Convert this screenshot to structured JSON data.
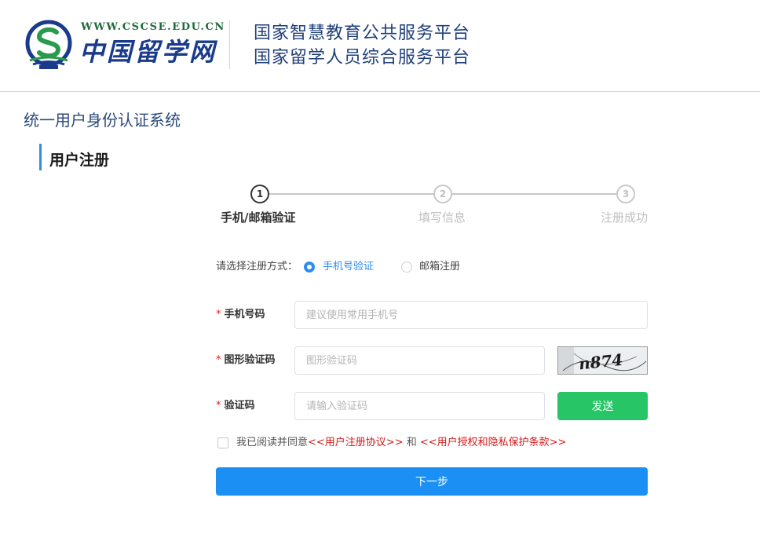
{
  "header": {
    "logo_url": "WWW.CSCSE.EDU.CN",
    "logo_name": "中国留学网",
    "platform_line1": "国家智慧教育公共服务平台",
    "platform_line2": "国家留学人员综合服务平台"
  },
  "system_title": "统一用户身份认证系统",
  "section_title": "用户注册",
  "steps": [
    {
      "number": "1",
      "label": "手机/邮箱验证",
      "active": true
    },
    {
      "number": "2",
      "label": "填写信息",
      "active": false
    },
    {
      "number": "3",
      "label": "注册成功",
      "active": false
    }
  ],
  "method": {
    "label": "请选择注册方式：",
    "options": [
      {
        "label": "手机号验证",
        "selected": true
      },
      {
        "label": "邮箱注册",
        "selected": false
      }
    ]
  },
  "form": {
    "required_mark": "*",
    "phone": {
      "label": "手机号码",
      "placeholder": "建议使用常用手机号",
      "value": ""
    },
    "captcha": {
      "label": "图形验证码",
      "placeholder": "图形验证码",
      "value": "",
      "image_text": "n874"
    },
    "code": {
      "label": "验证码",
      "placeholder": "请输入验证码",
      "value": "",
      "send_label": "发送"
    }
  },
  "agreement": {
    "prefix": "我已阅读并同意",
    "link1": "<<用户注册协议>>",
    "conjunction": " 和 ",
    "link2": "<<用户授权和隐私保护条款>>",
    "checked": false
  },
  "next_button": "下一步",
  "colors": {
    "primary": "#1c8ff5",
    "send": "#27c566",
    "link_red": "#d41919",
    "title_blue": "#2b4a7c"
  }
}
